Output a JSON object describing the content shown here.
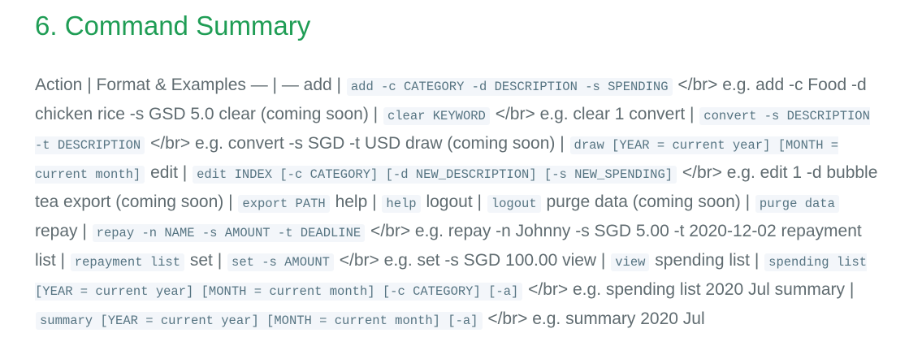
{
  "heading": "6. Command Summary",
  "segments": [
    {
      "t": "text",
      "v": "Action | Format & Examples — | — add | "
    },
    {
      "t": "code",
      "v": "add -c CATEGORY -d DESCRIPTION -s SPENDING"
    },
    {
      "t": "text",
      "v": " </br> e.g. add -c Food -d chicken rice -s GSD 5.0 clear (coming soon) | "
    },
    {
      "t": "code",
      "v": "clear KEYWORD"
    },
    {
      "t": "text",
      "v": " </br> e.g. clear 1 convert | "
    },
    {
      "t": "code",
      "v": "convert -s DESCRIPTION -t DESCRIPTION"
    },
    {
      "t": "text",
      "v": " </br> e.g. convert -s SGD -t USD draw (coming soon) | "
    },
    {
      "t": "code",
      "v": "draw [YEAR = current year] [MONTH = current month]"
    },
    {
      "t": "text",
      "v": " edit | "
    },
    {
      "t": "code",
      "v": "edit INDEX [-c CATEGORY] [-d NEW_DESCRIPTION] [-s NEW_SPENDING]"
    },
    {
      "t": "text",
      "v": " </br> e.g. edit 1 -d bubble tea export (coming soon) | "
    },
    {
      "t": "code",
      "v": "export PATH"
    },
    {
      "t": "text",
      "v": " help | "
    },
    {
      "t": "code",
      "v": "help"
    },
    {
      "t": "text",
      "v": " logout | "
    },
    {
      "t": "code",
      "v": "logout"
    },
    {
      "t": "text",
      "v": " purge data (coming soon) | "
    },
    {
      "t": "code",
      "v": "purge data"
    },
    {
      "t": "text",
      "v": " repay | "
    },
    {
      "t": "code",
      "v": "repay -n NAME -s AMOUNT -t DEADLINE"
    },
    {
      "t": "text",
      "v": " </br> e.g. repay -n Johnny -s SGD 5.00 -t 2020-12-02 repayment list | "
    },
    {
      "t": "code",
      "v": "repayment list"
    },
    {
      "t": "text",
      "v": " set | "
    },
    {
      "t": "code",
      "v": "set -s AMOUNT"
    },
    {
      "t": "text",
      "v": " </br> e.g. set -s SGD 100.00 view | "
    },
    {
      "t": "code",
      "v": "view"
    },
    {
      "t": "text",
      "v": " spending list | "
    },
    {
      "t": "code",
      "v": "spending list [YEAR = current year] [MONTH = current month] [-c CATEGORY] [-a]"
    },
    {
      "t": "text",
      "v": " </br> e.g. spending list 2020 Jul summary | "
    },
    {
      "t": "code",
      "v": "summary [YEAR = current year] [MONTH = current month] [-a]"
    },
    {
      "t": "text",
      "v": " </br> e.g. summary 2020 Jul"
    }
  ]
}
